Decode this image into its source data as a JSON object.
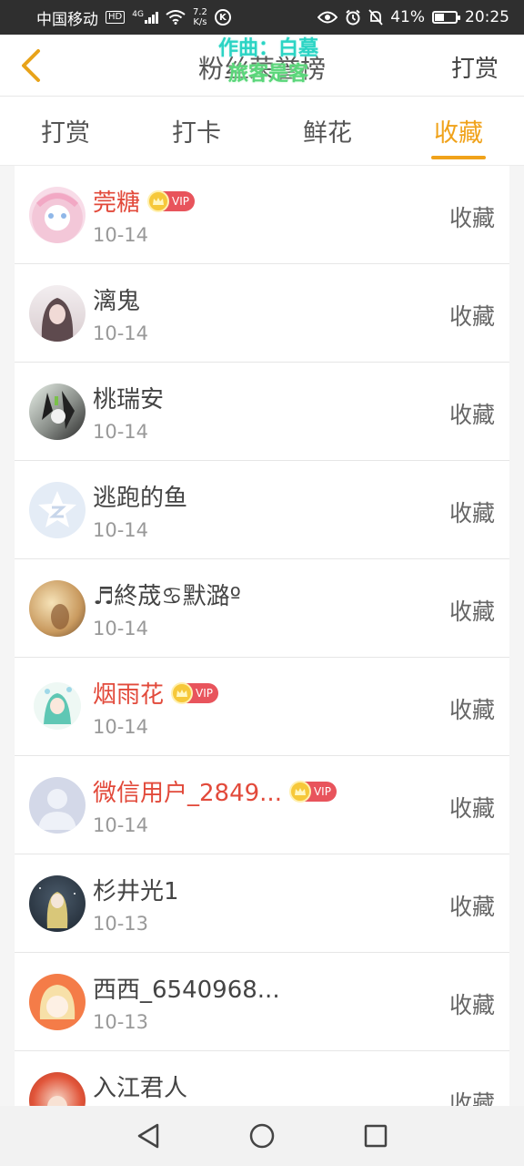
{
  "status_bar": {
    "carrier": "中国移动",
    "hd": "HD",
    "signal": "4G",
    "speed_top": "7.2",
    "speed_bottom": "K/s",
    "k_icon": "K",
    "battery_percent": "41%",
    "battery_level": 0.41,
    "time": "20:25"
  },
  "header": {
    "title": "粉丝荣誉榜",
    "overlay_line1": "作曲：白墓",
    "overlay_line2": "旅客是客",
    "action": "打赏"
  },
  "tabs": [
    {
      "label": "打赏",
      "active": false
    },
    {
      "label": "打卡",
      "active": false
    },
    {
      "label": "鲜花",
      "active": false
    },
    {
      "label": "收藏",
      "active": true
    }
  ],
  "vip_label": "VIP",
  "rows": [
    {
      "name": "莞糖",
      "vip": true,
      "date": "10-14",
      "action": "收藏"
    },
    {
      "name": "漓鬼",
      "vip": false,
      "date": "10-14",
      "action": "收藏"
    },
    {
      "name": "桃瑞安",
      "vip": false,
      "date": "10-14",
      "action": "收藏"
    },
    {
      "name": "逃跑的鱼",
      "vip": false,
      "date": "10-14",
      "action": "收藏"
    },
    {
      "name": "♬終荿♋默潞º",
      "vip": false,
      "date": "10-14",
      "action": "收藏"
    },
    {
      "name": "烟雨花",
      "vip": true,
      "date": "10-14",
      "action": "收藏"
    },
    {
      "name": "微信用户_2849...",
      "vip": true,
      "date": "10-14",
      "action": "收藏"
    },
    {
      "name": "杉井光1",
      "vip": false,
      "date": "10-13",
      "action": "收藏"
    },
    {
      "name": "西西_6540968...",
      "vip": false,
      "date": "10-13",
      "action": "收藏"
    },
    {
      "name": "入江君人",
      "vip": false,
      "date": "",
      "action": "收藏"
    }
  ],
  "colors": {
    "accent": "#f0a21a",
    "vip_name": "#e24a3b",
    "vip_badge": "#e8545c"
  }
}
